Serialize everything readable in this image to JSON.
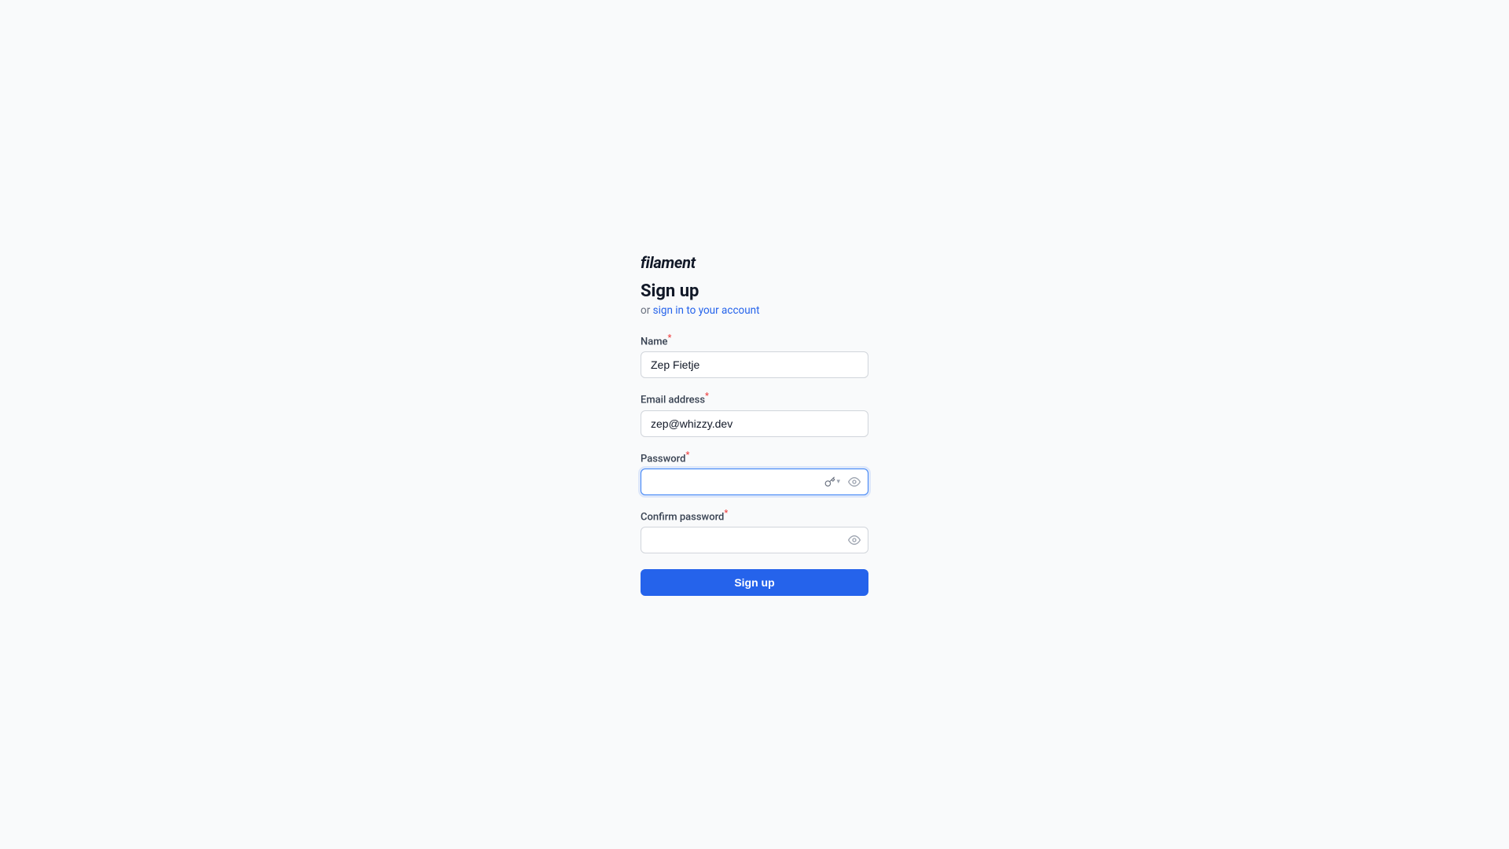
{
  "app": {
    "logo": "filament",
    "page_title": "Sign up",
    "sign_in_prefix": "or",
    "sign_in_link_text": "sign in to your account",
    "sign_in_href": "#"
  },
  "fields": {
    "name": {
      "label": "Name",
      "required": true,
      "value": "Zep Fietje",
      "placeholder": ""
    },
    "email": {
      "label": "Email address",
      "required": true,
      "value": "zep@whizzy.dev",
      "placeholder": ""
    },
    "password": {
      "label": "Password",
      "required": true,
      "value": "",
      "placeholder": ""
    },
    "confirm_password": {
      "label": "Confirm password",
      "required": true,
      "value": "",
      "placeholder": ""
    }
  },
  "buttons": {
    "signup_label": "Sign up"
  },
  "icons": {
    "eye": "eye-icon",
    "key": "key-icon",
    "chevron_down": "chevron-down-icon"
  }
}
